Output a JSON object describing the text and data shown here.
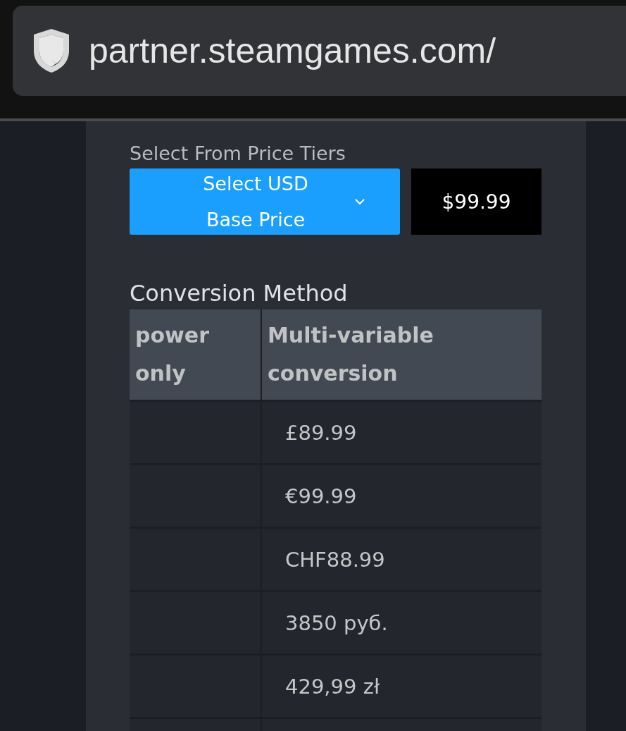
{
  "address_bar": {
    "url": "partner.steamgames.com/"
  },
  "price_tiers": {
    "label": "Select From Price Tiers",
    "dropdown": "Select USD Base Price",
    "price": "$99.99"
  },
  "conversion": {
    "label": "Conversion Method",
    "columns": [
      "power only",
      "Multi-variable conversion"
    ],
    "rows": [
      {
        "column_2": "£89.99"
      },
      {
        "column_2": "€99.99"
      },
      {
        "column_2": "CHF88.99"
      },
      {
        "column_2": "3850 руб."
      },
      {
        "column_2": "429,99 zł"
      }
    ]
  }
}
